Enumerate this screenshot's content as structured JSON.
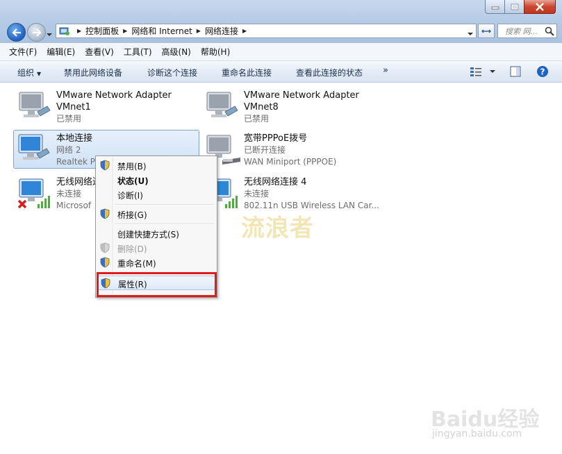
{
  "address_bar": {
    "crumbs": [
      "控制面板",
      "网络和 Internet",
      "网络连接"
    ],
    "search_placeholder": "搜索 网..."
  },
  "menu": [
    "文件(F)",
    "编辑(E)",
    "查看(V)",
    "工具(T)",
    "高级(N)",
    "帮助(H)"
  ],
  "toolbar": {
    "organize": "组织",
    "disable": "禁用此网络设备",
    "diagnose": "诊断这个连接",
    "rename": "重命名此连接",
    "view_status": "查看此连接的状态",
    "more": "»"
  },
  "connections": [
    {
      "name": "VMware Network Adapter",
      "status": "VMnet1",
      "adapter": "已禁用"
    },
    {
      "name": "VMware Network Adapter",
      "status": "VMnet8",
      "adapter": "已禁用"
    },
    {
      "name": "本地连接",
      "status": "网络 2",
      "adapter": "Realtek P"
    },
    {
      "name": "宽带PPPoE拨号",
      "status": "已断开连接",
      "adapter": "WAN Miniport (PPPOE)"
    },
    {
      "name": "无线网络连",
      "status": "未连接",
      "adapter": "Microsof"
    },
    {
      "name": "无线网络连接 4",
      "status": "未连接",
      "adapter": "802.11n USB Wireless LAN Car..."
    }
  ],
  "context_menu": {
    "disable": "禁用(B)",
    "status": "状态(U)",
    "diagnose": "诊断(I)",
    "bridge": "桥接(G)",
    "shortcut": "创建快捷方式(S)",
    "delete": "删除(D)",
    "rename": "重命名(M)",
    "properties": "属性(R)"
  },
  "watermark": "流浪者",
  "baidu": {
    "logo": "Baidu经验",
    "url": "jingyan.baidu.com"
  },
  "colors": {
    "highlight": "#e01b1b",
    "selection": "#cfe1f6"
  }
}
